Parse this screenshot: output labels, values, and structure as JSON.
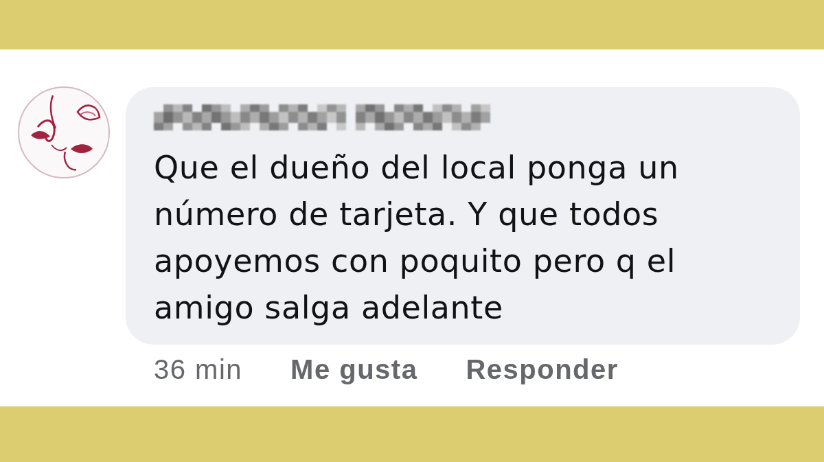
{
  "comment": {
    "text": "Que el dueño del local ponga un número de tarjeta. Y que todos apoyemos con poquito pero q el amigo salga adelante",
    "time": "36 min",
    "actions": [
      "Me gusta",
      "Responder"
    ]
  }
}
